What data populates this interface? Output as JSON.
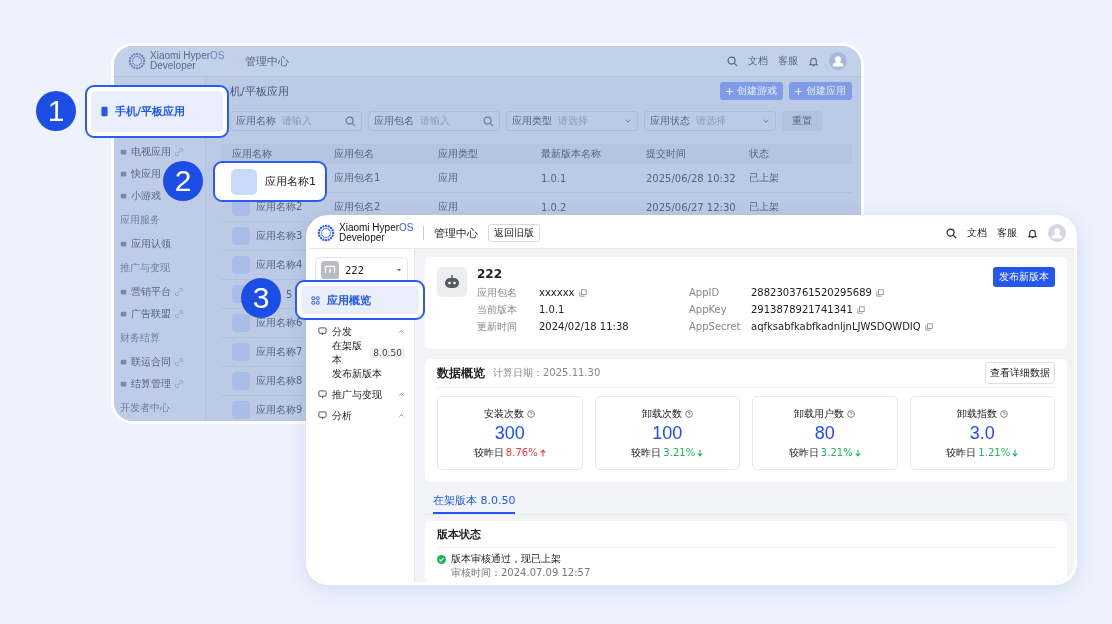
{
  "back_window": {
    "logo": {
      "line1": "Xiaomi Hyper",
      "line1_accent": "OS",
      "line2": "Developer"
    },
    "header_title": "管理中心",
    "header_links": [
      "文档",
      "客服"
    ],
    "sidebar": [
      {
        "items": [
          {
            "label": "电视应用",
            "external": true
          },
          {
            "label": "快应用",
            "external": false
          },
          {
            "label": "小游戏",
            "external": false
          }
        ]
      },
      {
        "title": "应用服务",
        "items": [
          {
            "label": "应用认领",
            "external": false
          }
        ]
      },
      {
        "title": "推广与变现",
        "items": [
          {
            "label": "营销平台",
            "external": true
          },
          {
            "label": "广告联盟",
            "external": true
          }
        ]
      },
      {
        "title": "财务结算",
        "items": [
          {
            "label": "联运合同",
            "external": true
          },
          {
            "label": "结算管理",
            "external": true
          }
        ]
      },
      {
        "title": "开发者中心"
      }
    ],
    "page_title": "机/平板应用",
    "actions": [
      "创建游戏",
      "创建应用"
    ],
    "filters": [
      {
        "label": "应用名称",
        "placeholder": "请输入",
        "kind": "search"
      },
      {
        "label": "应用包名",
        "placeholder": "请输入",
        "kind": "search"
      },
      {
        "label": "应用类型",
        "placeholder": "请选择",
        "kind": "select"
      },
      {
        "label": "应用状态",
        "placeholder": "请选择",
        "kind": "select"
      }
    ],
    "reset": "重置",
    "table": {
      "columns": [
        "应用名称",
        "应用包名",
        "应用类型",
        "最新版本名称",
        "提交时间",
        "状态"
      ],
      "rows": [
        {
          "cells": [
            "",
            "应用包名1",
            "应用",
            "1.0.1",
            "2025/06/28 10:32",
            "已上架"
          ]
        },
        {
          "cells": [
            "应用名称2",
            "应用包名2",
            "应用",
            "1.0.2",
            "2025/06/27 12:30",
            "已上架"
          ]
        },
        {
          "cells": [
            "应用名称3"
          ]
        },
        {
          "cells": [
            "应用名称4"
          ]
        },
        {
          "cells": [
            "5"
          ],
          "cut_left": true
        },
        {
          "cells": [
            "应用名称6"
          ]
        },
        {
          "cells": [
            "应用名称7"
          ]
        },
        {
          "cells": [
            "应用名称8"
          ]
        },
        {
          "cells": [
            "应用名称9"
          ]
        }
      ]
    }
  },
  "front_window": {
    "logo": {
      "line1": "Xiaomi Hyper",
      "line1_accent": "OS",
      "line2": "Developer"
    },
    "header_title": "管理中心",
    "back_button": "返回旧版",
    "header_links": [
      "文档",
      "客服"
    ],
    "app_selector": "222",
    "nav": [
      {
        "label": "分发",
        "kind": "section",
        "expanded": true
      },
      {
        "label": "在架版本",
        "badge": "8.0.50",
        "kind": "sub"
      },
      {
        "label": "发布新版本",
        "kind": "sub"
      },
      {
        "label": "推广与变现",
        "kind": "section",
        "expanded": true
      },
      {
        "label": "分析",
        "kind": "section",
        "expanded": true
      }
    ],
    "app": {
      "name": "222",
      "publish_button": "发布新版本",
      "fields_left": [
        {
          "label": "应用包名",
          "value": "xxxxxx",
          "copyable": true
        },
        {
          "label": "当前版本",
          "value": "1.0.1",
          "copyable": false
        },
        {
          "label": "更新时间",
          "value": "2024/02/18 11:38",
          "copyable": false
        }
      ],
      "fields_right": [
        {
          "label": "AppID",
          "value": "2882303761520295689",
          "copyable": true
        },
        {
          "label": "AppKey",
          "value": "2913878921741341",
          "copyable": true
        },
        {
          "label": "AppSecret",
          "value": "aqfksabfkabfkadnljnLJWSDQWDIQ",
          "copyable": true
        }
      ]
    },
    "overview": {
      "title": "数据概览",
      "date": "计算日期：2025.11.30",
      "detail_button": "查看详细数据",
      "stats": [
        {
          "label": "安装次数",
          "value": "300",
          "compare": "较昨日",
          "change": "8.76%",
          "rising": true
        },
        {
          "label": "卸载次数",
          "value": "100",
          "compare": "较昨日",
          "change": "3.21%",
          "rising": false
        },
        {
          "label": "卸载用户数",
          "value": "80",
          "compare": "较昨日",
          "change": "3.21%",
          "rising": false
        },
        {
          "label": "卸载指数",
          "value": "3.0",
          "compare": "较昨日",
          "change": "1.21%",
          "rising": false
        }
      ]
    },
    "tabs": [
      {
        "label": "在架版本 8.0.50",
        "selected": true
      }
    ],
    "status": {
      "title": "版本状态",
      "message": "版本审核通过，现已上架",
      "time": "审核时间：2024.07.09 12:57"
    }
  },
  "callouts": [
    {
      "number": "1",
      "label": "手机/平板应用"
    },
    {
      "number": "2",
      "label": "应用名称1"
    },
    {
      "number": "3",
      "label": "应用概览"
    }
  ]
}
